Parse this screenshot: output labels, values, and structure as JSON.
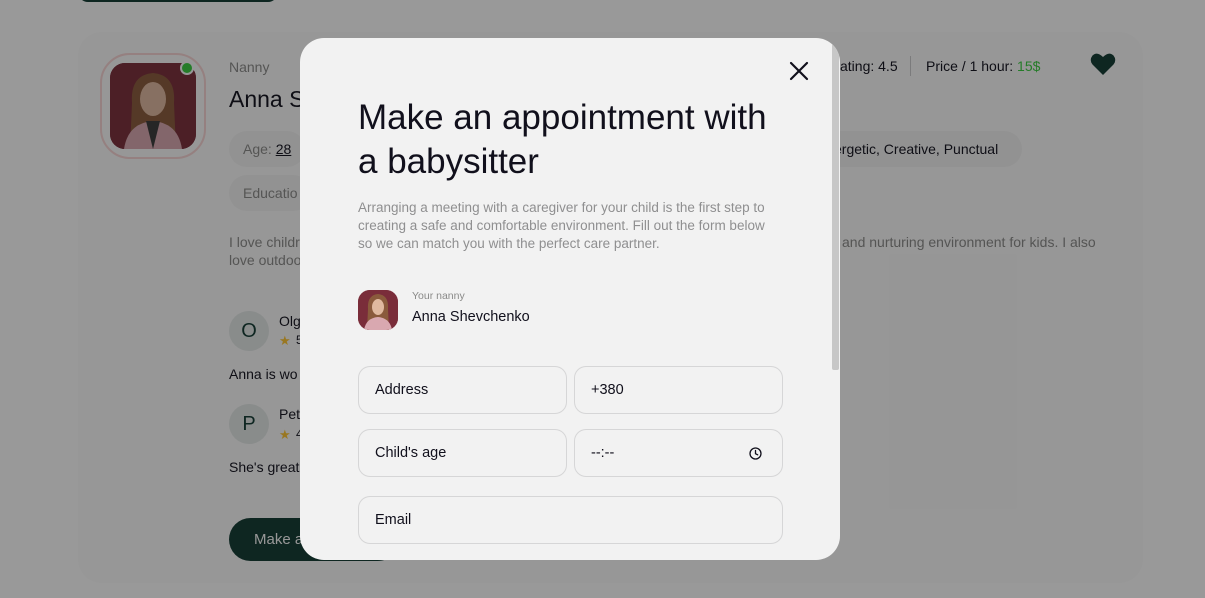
{
  "background": {
    "profile": {
      "role_label": "Nanny",
      "name_partial": "Anna S",
      "age_label": "Age:",
      "age_value": "28",
      "education_partial": "Educatio",
      "characters_partial": "ergetic, Creative, Punctual",
      "rating_partial": "ating: 4.5",
      "price_label": "Price / 1 hour:",
      "price_value": "15$",
      "about_line1_left": "I love childr",
      "about_line1_right": "and nurturing environment for kids. I also",
      "about_line2_left": "love outdoo"
    },
    "reviews": [
      {
        "initial": "O",
        "name_partial": "Olg",
        "rating_partial": "5",
        "text_partial": "Anna is wo"
      },
      {
        "initial": "P",
        "name_partial": "Pet",
        "rating_partial": "4",
        "text_partial": "She's great"
      }
    ],
    "button_partial": "Make a",
    "colors": {
      "accent": "#103931",
      "online": "#38cd3e",
      "price": "#38cd3e",
      "star": "#ffc531"
    }
  },
  "modal": {
    "title": "Make an appointment with a babysitter",
    "description": "Arranging a meeting with a caregiver for your child is the first step to creating a safe and comfortable environment. Fill out the form below so we can match you with the perfect care partner.",
    "nanny_caption": "Your nanny",
    "nanny_name": "Anna Shevchenko",
    "fields": {
      "address": "Address",
      "phone": "+380",
      "child_age": "Child's age",
      "time": "--:--",
      "email": "Email"
    },
    "icons": {
      "close": "close-icon",
      "clock": "clock-icon"
    }
  }
}
